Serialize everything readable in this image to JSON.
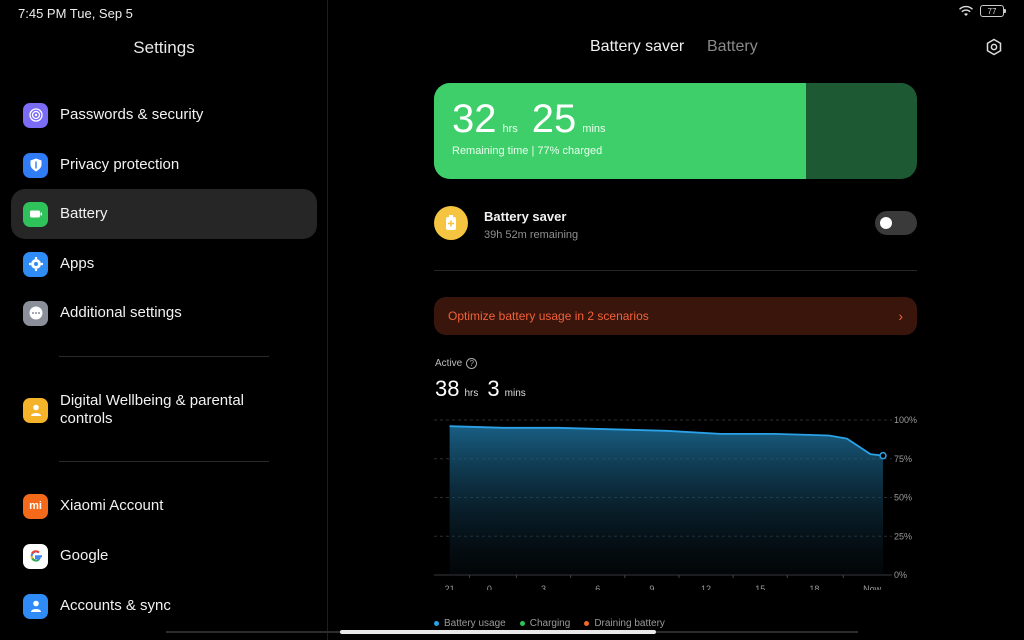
{
  "status_bar": {
    "time": "7:45 PM Tue, Sep 5",
    "battery_level": "77"
  },
  "left": {
    "title": "Settings",
    "items": [
      {
        "label": "Passwords & security",
        "icon": "fingerprint-icon",
        "color": "#7b6cf6"
      },
      {
        "label": "Privacy protection",
        "icon": "privacy-shield-icon",
        "color": "#2f7cf6"
      },
      {
        "label": "Battery",
        "icon": "battery-icon",
        "color": "#2fc25a"
      },
      {
        "label": "Apps",
        "icon": "gear-icon",
        "color": "#2f8cf6"
      },
      {
        "label": "Additional settings",
        "icon": "more-dots-icon",
        "color": "#8a8f9a"
      },
      {
        "label": "Digital Wellbeing & parental controls",
        "icon": "person-icon",
        "color": "#f5b32a"
      },
      {
        "label": "Xiaomi Account",
        "icon": "mi-icon",
        "color": "#f56a1a"
      },
      {
        "label": "Google",
        "icon": "google-icon",
        "color": "#ffffff"
      },
      {
        "label": "Accounts & sync",
        "icon": "account-icon",
        "color": "#2f8cf6"
      }
    ]
  },
  "right": {
    "tabs": [
      "Battery saver",
      "Battery"
    ],
    "hero": {
      "hours": "32",
      "hours_unit": "hrs",
      "mins": "25",
      "mins_unit": "mins",
      "subtitle": "Remaining time | 77% charged",
      "charge_fraction": 0.77
    },
    "saver": {
      "title": "Battery saver",
      "subtitle": "39h 52m remaining",
      "enabled": false
    },
    "optimize": {
      "label": "Optimize battery usage in 2 scenarios"
    },
    "active": {
      "label": "Active",
      "hours": "38",
      "hours_unit": "hrs",
      "mins": "3",
      "mins_unit": "mins"
    },
    "legend": [
      "Battery usage",
      "Charging",
      "Draining battery"
    ]
  },
  "chart_data": {
    "type": "area",
    "x_labels": [
      "21",
      "0",
      "3",
      "6",
      "9",
      "12",
      "15",
      "18",
      "Now"
    ],
    "y_labels": [
      "100%",
      "75%",
      "50%",
      "25%",
      "0%"
    ],
    "ylim": [
      0,
      100
    ],
    "series": [
      {
        "name": "Battery usage",
        "color": "#2aa2e8",
        "x": [
          0,
          3,
          6,
          9,
          12,
          15,
          18,
          21,
          22,
          23.3,
          24
        ],
        "values": [
          96,
          95,
          95,
          94,
          93,
          91,
          91,
          90,
          88,
          78,
          77
        ]
      }
    ],
    "x_range": [
      -0.7,
      24
    ]
  }
}
